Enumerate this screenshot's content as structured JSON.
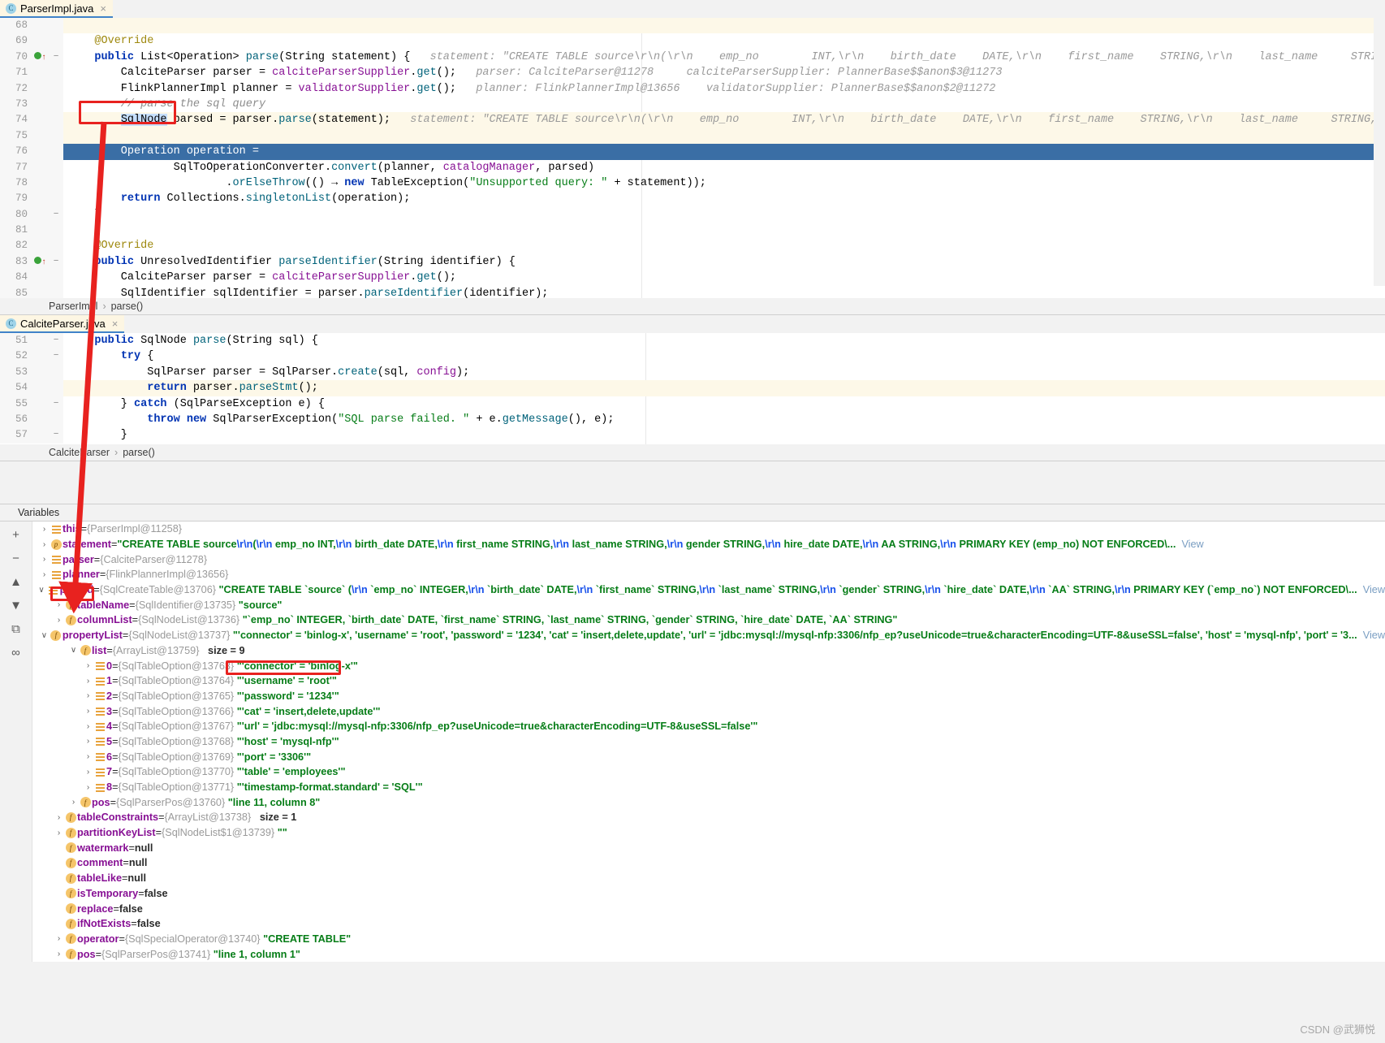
{
  "window": {
    "watermark": "CSDN @武狮悦"
  },
  "editor_top": {
    "tab": {
      "label": "ParserImpl.java",
      "icon": "java-class-icon",
      "close": "×"
    },
    "breadcrumb": {
      "class": "ParserImpl",
      "sep": "›",
      "method": "parse()"
    },
    "lines": [
      {
        "num": "68",
        "code": "",
        "hint": ""
      },
      {
        "num": "69",
        "code": "    @Override",
        "hint": ""
      },
      {
        "num": "70",
        "code": "    public List<Operation> parse(String statement) {",
        "hint": "statement: \"CREATE TABLE source\\r\\n(\\r\\n    emp_no        INT,\\r\\n    birth_date    DATE,\\r\\n    first_name    STRING,\\r\\n    last_name     STRING,\\r\\n"
      },
      {
        "num": "71",
        "code": "        CalciteParser parser = calciteParserSupplier.get();",
        "hint": "parser: CalciteParser@11278     calciteParserSupplier: PlannerBase$$anon$3@11273"
      },
      {
        "num": "72",
        "code": "        FlinkPlannerImpl planner = validatorSupplier.get();",
        "hint": "planner: FlinkPlannerImpl@13656    validatorSupplier: PlannerBase$$anon$2@11272"
      },
      {
        "num": "73",
        "code": "        // parse the sql query",
        "hint": ""
      },
      {
        "num": "74",
        "code": "        SqlNode parsed = parser.parse(statement);",
        "hint": "statement: \"CREATE TABLE source\\r\\n(\\r\\n    emp_no        INT,\\r\\n    birth_date    DATE,\\r\\n    first_name    STRING,\\r\\n    last_name     STRING,\\r\\n"
      },
      {
        "num": "75",
        "code": "",
        "hint": ""
      },
      {
        "num": "76",
        "code": "        Operation operation =",
        "hint": ""
      },
      {
        "num": "77",
        "code": "                SqlToOperationConverter.convert(planner, catalogManager, parsed)",
        "hint": ""
      },
      {
        "num": "78",
        "code": "                        .orElseThrow(() -> new TableException(\"Unsupported query: \" + statement));",
        "hint": ""
      },
      {
        "num": "79",
        "code": "        return Collections.singletonList(operation);",
        "hint": ""
      },
      {
        "num": "80",
        "code": "    }",
        "hint": ""
      },
      {
        "num": "81",
        "code": "",
        "hint": ""
      },
      {
        "num": "82",
        "code": "    @Override",
        "hint": ""
      },
      {
        "num": "83",
        "code": "    public UnresolvedIdentifier parseIdentifier(String identifier) {",
        "hint": ""
      },
      {
        "num": "84",
        "code": "        CalciteParser parser = calciteParserSupplier.get();",
        "hint": ""
      },
      {
        "num": "85",
        "code": "        SqlIdentifier sqlIdentifier = parser.parseIdentifier(identifier);",
        "hint": ""
      }
    ]
  },
  "editor_bottom": {
    "tab": {
      "label": "CalciteParser.java",
      "icon": "java-class-icon",
      "close": "×"
    },
    "breadcrumb": {
      "class": "CalciteParser",
      "sep": "›",
      "method": "parse()"
    },
    "lines": [
      {
        "num": "51",
        "code": "    public SqlNode parse(String sql) {"
      },
      {
        "num": "52",
        "code": "        try {"
      },
      {
        "num": "53",
        "code": "            SqlParser parser = SqlParser.create(sql, config);"
      },
      {
        "num": "54",
        "code": "            return parser.parseStmt();"
      },
      {
        "num": "55",
        "code": "        } catch (SqlParseException e) {"
      },
      {
        "num": "56",
        "code": "            throw new SqlParserException(\"SQL parse failed. \" + e.getMessage(), e);"
      },
      {
        "num": "57",
        "code": "        }"
      }
    ]
  },
  "variables": {
    "title": "Variables",
    "toolbar": [
      {
        "name": "add-watch-button",
        "glyph": "+"
      },
      {
        "name": "remove-watch-button",
        "glyph": "−"
      },
      {
        "name": "scroll-up-button",
        "glyph": "▲"
      },
      {
        "name": "scroll-down-button",
        "glyph": "▼"
      },
      {
        "name": "copy-value-button",
        "glyph": "⧉"
      },
      {
        "name": "inspect-button",
        "glyph": "∞"
      }
    ],
    "view_label": "View",
    "rows": [
      {
        "indent": 0,
        "arrow": "›",
        "icon": "list",
        "name": "this",
        "eq": " = ",
        "ref": "{ParserImpl@11258}",
        "value": "",
        "view": false
      },
      {
        "indent": 0,
        "arrow": "›",
        "icon": "p",
        "name": "statement",
        "eq": " = ",
        "ref": "",
        "value": "\"CREATE TABLE source\\r\\n(\\r\\n    emp_no        INT,\\r\\n    birth_date    DATE,\\r\\n    first_name    STRING,\\r\\n    last_name     STRING,\\r\\n    gender        STRING,\\r\\n    hire_date     DATE,\\r\\n    AA            STRING,\\r\\n    PRIMARY KEY (emp_no) NOT ENFORCED\\...",
        "view": true
      },
      {
        "indent": 0,
        "arrow": "›",
        "icon": "list",
        "name": "parser",
        "eq": " = ",
        "ref": "{CalciteParser@11278}",
        "value": "",
        "view": false
      },
      {
        "indent": 0,
        "arrow": "›",
        "icon": "list",
        "name": "planner",
        "eq": " = ",
        "ref": "{FlinkPlannerImpl@13656}",
        "value": "",
        "view": false
      },
      {
        "indent": 0,
        "arrow": "∨",
        "icon": "list",
        "name": "parsed",
        "eq": " = ",
        "ref": "{SqlCreateTable@13706}",
        "value": "\"CREATE TABLE `source` (\\r\\n  `emp_no` INTEGER,\\r\\n  `birth_date` DATE,\\r\\n  `first_name` STRING,\\r\\n  `last_name` STRING,\\r\\n  `gender` STRING,\\r\\n  `hire_date` DATE,\\r\\n  `AA` STRING,\\r\\n  PRIMARY KEY (`emp_no`) NOT ENFORCED\\...",
        "view": true,
        "boxed": true
      },
      {
        "indent": 1,
        "arrow": "›",
        "icon": "f",
        "name": "tableName",
        "eq": " = ",
        "ref": "{SqlIdentifier@13735}",
        "value": "\"source\"",
        "view": false
      },
      {
        "indent": 1,
        "arrow": "›",
        "icon": "f",
        "name": "columnList",
        "eq": " = ",
        "ref": "{SqlNodeList@13736}",
        "value": "\"`emp_no` INTEGER, `birth_date` DATE, `first_name` STRING, `last_name` STRING, `gender` STRING, `hire_date` DATE, `AA` STRING\"",
        "view": false
      },
      {
        "indent": 1,
        "arrow": "∨",
        "icon": "f",
        "name": "propertyList",
        "eq": " = ",
        "ref": "{SqlNodeList@13737}",
        "value": "\"'connector' = 'binlog-x', 'username' = 'root', 'password' = '1234', 'cat' = 'insert,delete,update', 'url' = 'jdbc:mysql://mysql-nfp:3306/nfp_ep?useUnicode=true&characterEncoding=UTF-8&useSSL=false', 'host' = 'mysql-nfp', 'port' = '3...",
        "view": true
      },
      {
        "indent": 2,
        "arrow": "∨",
        "icon": "f",
        "name": "list",
        "eq": " = ",
        "ref": "{ArrayList@13759}",
        "value": "",
        "extra": "size = 9",
        "view": false
      },
      {
        "indent": 3,
        "arrow": "›",
        "icon": "list",
        "name": "0",
        "eq": " = ",
        "ref": "{SqlTableOption@13763}",
        "value": "\"'connector' = 'binlog-x'\"",
        "view": false,
        "boxed": true
      },
      {
        "indent": 3,
        "arrow": "›",
        "icon": "list",
        "name": "1",
        "eq": " = ",
        "ref": "{SqlTableOption@13764}",
        "value": "\"'username' = 'root'\"",
        "view": false
      },
      {
        "indent": 3,
        "arrow": "›",
        "icon": "list",
        "name": "2",
        "eq": " = ",
        "ref": "{SqlTableOption@13765}",
        "value": "\"'password' = '1234'\"",
        "view": false
      },
      {
        "indent": 3,
        "arrow": "›",
        "icon": "list",
        "name": "3",
        "eq": " = ",
        "ref": "{SqlTableOption@13766}",
        "value": "\"'cat' = 'insert,delete,update'\"",
        "view": false
      },
      {
        "indent": 3,
        "arrow": "›",
        "icon": "list",
        "name": "4",
        "eq": " = ",
        "ref": "{SqlTableOption@13767}",
        "value": "\"'url' = 'jdbc:mysql://mysql-nfp:3306/nfp_ep?useUnicode=true&characterEncoding=UTF-8&useSSL=false'\"",
        "view": false
      },
      {
        "indent": 3,
        "arrow": "›",
        "icon": "list",
        "name": "5",
        "eq": " = ",
        "ref": "{SqlTableOption@13768}",
        "value": "\"'host' = 'mysql-nfp'\"",
        "view": false
      },
      {
        "indent": 3,
        "arrow": "›",
        "icon": "list",
        "name": "6",
        "eq": " = ",
        "ref": "{SqlTableOption@13769}",
        "value": "\"'port' = '3306'\"",
        "view": false
      },
      {
        "indent": 3,
        "arrow": "›",
        "icon": "list",
        "name": "7",
        "eq": " = ",
        "ref": "{SqlTableOption@13770}",
        "value": "\"'table' = 'employees'\"",
        "view": false
      },
      {
        "indent": 3,
        "arrow": "›",
        "icon": "list",
        "name": "8",
        "eq": " = ",
        "ref": "{SqlTableOption@13771}",
        "value": "\"'timestamp-format.standard' = 'SQL'\"",
        "view": false
      },
      {
        "indent": 2,
        "arrow": "›",
        "icon": "f",
        "name": "pos",
        "eq": " = ",
        "ref": "{SqlParserPos@13760}",
        "value": "\"line 11, column 8\"",
        "view": false
      },
      {
        "indent": 1,
        "arrow": "›",
        "icon": "f",
        "name": "tableConstraints",
        "eq": " = ",
        "ref": "{ArrayList@13738}",
        "value": "",
        "extra": "size = 1",
        "view": false
      },
      {
        "indent": 1,
        "arrow": "›",
        "icon": "f",
        "name": "partitionKeyList",
        "eq": " = ",
        "ref": "{SqlNodeList$1@13739}",
        "value": "\"\"",
        "view": false
      },
      {
        "indent": 1,
        "arrow": "",
        "icon": "f",
        "name": "watermark",
        "eq": " = ",
        "ref": "",
        "value": "null",
        "isnull": true,
        "view": false
      },
      {
        "indent": 1,
        "arrow": "",
        "icon": "f",
        "name": "comment",
        "eq": " = ",
        "ref": "",
        "value": "null",
        "isnull": true,
        "view": false
      },
      {
        "indent": 1,
        "arrow": "",
        "icon": "f",
        "name": "tableLike",
        "eq": " = ",
        "ref": "",
        "value": "null",
        "isnull": true,
        "view": false
      },
      {
        "indent": 1,
        "arrow": "",
        "icon": "f",
        "name": "isTemporary",
        "eq": " = ",
        "ref": "",
        "value": "false",
        "isnull": true,
        "view": false
      },
      {
        "indent": 1,
        "arrow": "",
        "icon": "f",
        "name": "replace",
        "eq": " = ",
        "ref": "",
        "value": "false",
        "isnull": true,
        "view": false
      },
      {
        "indent": 1,
        "arrow": "",
        "icon": "f",
        "name": "ifNotExists",
        "eq": " = ",
        "ref": "",
        "value": "false",
        "isnull": true,
        "view": false
      },
      {
        "indent": 1,
        "arrow": "›",
        "icon": "f",
        "name": "operator",
        "eq": " = ",
        "ref": "{SqlSpecialOperator@13740}",
        "value": "\"CREATE TABLE\"",
        "view": false
      },
      {
        "indent": 1,
        "arrow": "›",
        "icon": "f",
        "name": "pos",
        "eq": " = ",
        "ref": "{SqlParserPos@13741}",
        "value": "\"line 1, column 1\"",
        "view": false
      }
    ]
  },
  "annotations": {
    "callout_1": "sqlnode-parsed-highlight",
    "callout_2": "parsed-variable-highlight",
    "callout_3": "connector-binlog-x-highlight",
    "arrow": "red-arrow-from-code-to-variable"
  }
}
